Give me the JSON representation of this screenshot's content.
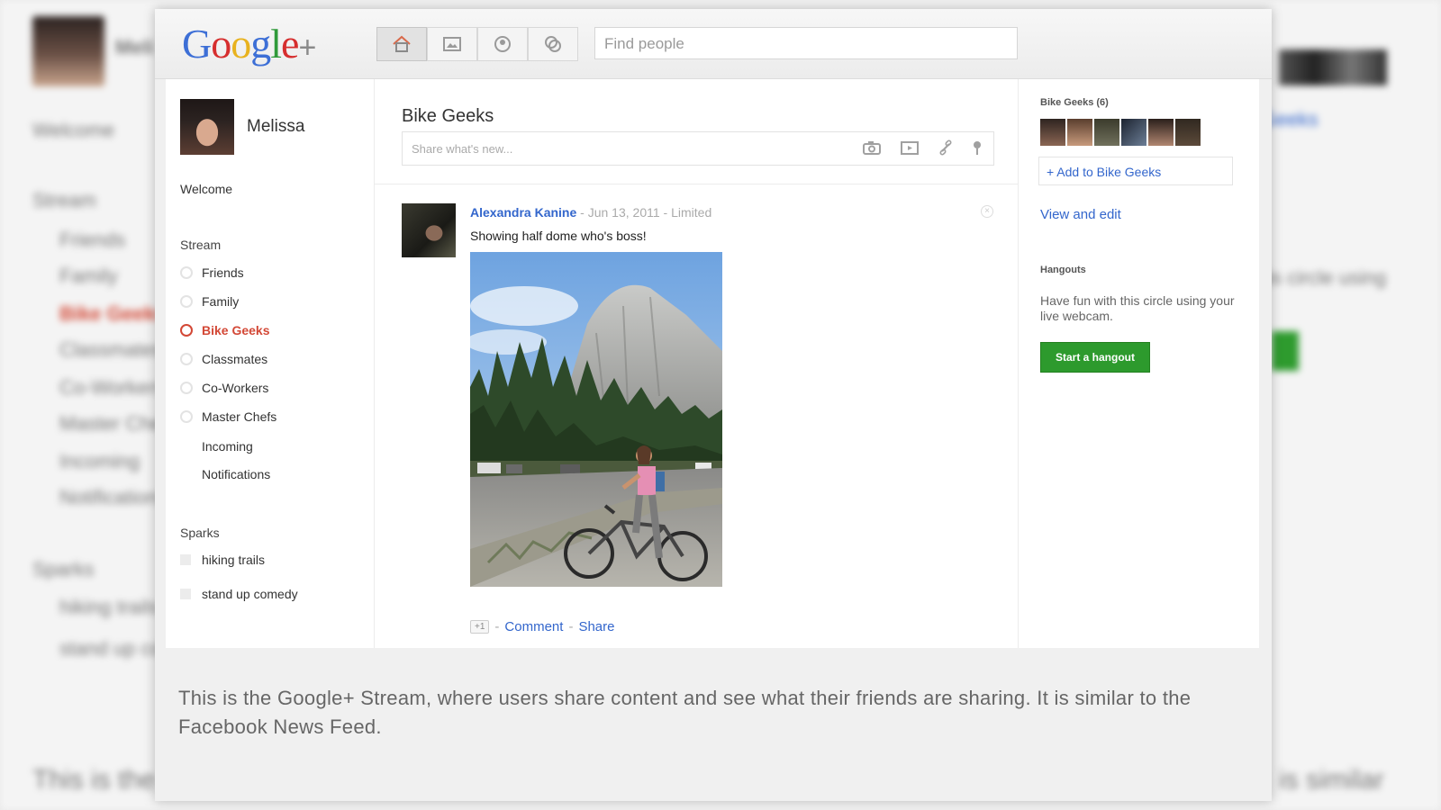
{
  "background": {
    "name_text": "Meli",
    "welcome": "Welcome",
    "stream": "Stream",
    "items": [
      "Friends",
      "Family",
      "Bike Geeks",
      "Classmates",
      "Co-Workers",
      "Master Chefs",
      "Incoming",
      "Notifications"
    ],
    "sparks": "Sparks",
    "spark_items": [
      "hiking trails",
      "stand up co"
    ],
    "view_link": "Geeks",
    "right_text": "his circle using",
    "caption_fragment_left": "This is the",
    "caption_fragment_right": "is similar"
  },
  "app": {
    "logo_letters": [
      "G",
      "o",
      "o",
      "g",
      "l",
      "e"
    ],
    "logo_plus": "+",
    "search_placeholder": "Find people"
  },
  "nav_icons": [
    "home-icon",
    "photos-icon",
    "profile-icon",
    "circles-icon"
  ],
  "profile": {
    "name": "Melissa"
  },
  "sidebar": {
    "welcome": "Welcome",
    "stream_title": "Stream",
    "stream_items": [
      {
        "label": "Friends",
        "active": false,
        "circle": true
      },
      {
        "label": "Family",
        "active": false,
        "circle": true
      },
      {
        "label": "Bike Geeks",
        "active": true,
        "circle": true
      },
      {
        "label": "Classmates",
        "active": false,
        "circle": true
      },
      {
        "label": "Co-Workers",
        "active": false,
        "circle": true
      },
      {
        "label": "Master Chefs",
        "active": false,
        "circle": true
      },
      {
        "label": "Incoming",
        "active": false,
        "circle": false
      },
      {
        "label": "Notifications",
        "active": false,
        "circle": false
      }
    ],
    "sparks_title": "Sparks",
    "sparks": [
      "hiking trails",
      "stand up comedy"
    ]
  },
  "main": {
    "circle_title": "Bike Geeks",
    "share_placeholder": "Share what's new...",
    "share_icons": [
      "camera-icon",
      "video-icon",
      "link-icon",
      "location-icon"
    ],
    "post": {
      "author": "Alexandra Kanine",
      "date": "Jun 13, 2011",
      "visibility": "Limited",
      "separator": "-",
      "text": "Showing half dome who's boss!",
      "plus_one": "+1",
      "comment": "Comment",
      "share": "Share"
    }
  },
  "right": {
    "circle_count": "Bike Geeks (6)",
    "member_count": 6,
    "add_label": "+ Add to Bike Geeks",
    "view_edit": "View and edit",
    "hangouts_title": "Hangouts",
    "hangouts_desc": "Have fun with this circle using your live webcam.",
    "hangout_button": "Start a hangout"
  },
  "caption": "This is the Google+ Stream, where users share content and see what their friends are sharing. It is similar to the Facebook News Feed."
}
